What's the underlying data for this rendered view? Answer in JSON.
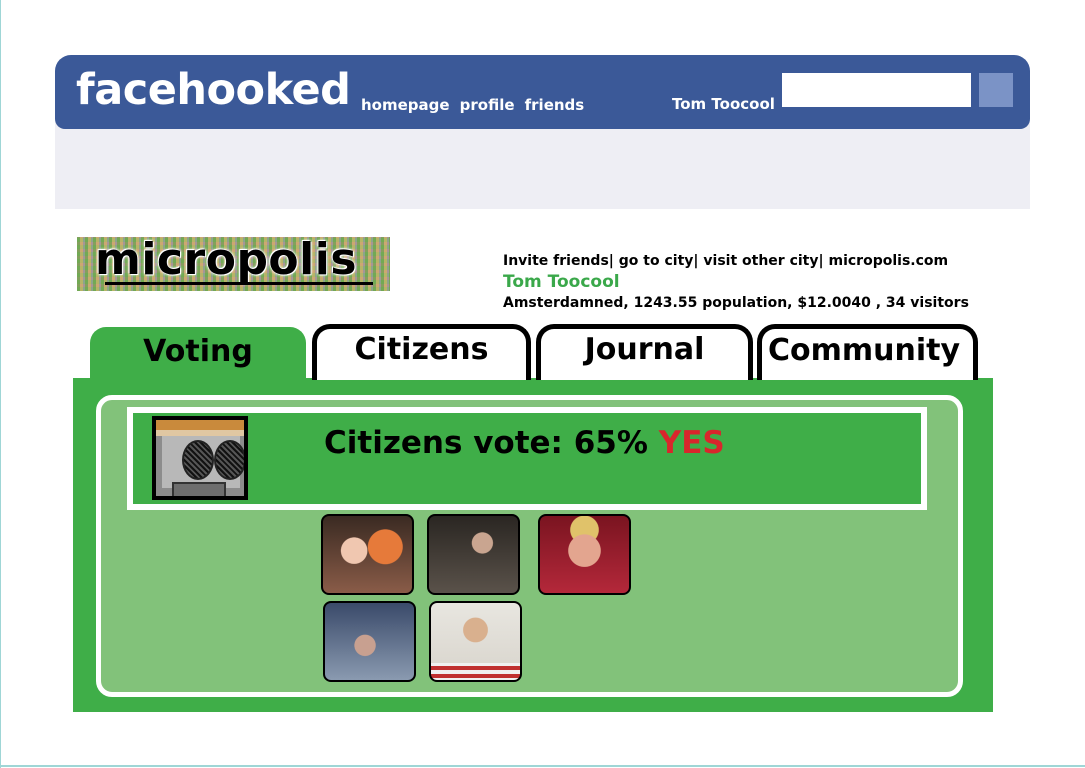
{
  "header": {
    "logo": "facehooked",
    "nav": [
      {
        "label": "homepage"
      },
      {
        "label": "profile"
      },
      {
        "label": "friends"
      }
    ],
    "user_name": "Tom Toocool",
    "search": {
      "value": "",
      "placeholder": ""
    }
  },
  "app": {
    "logo_text": "micropolis",
    "links": [
      {
        "label": "Invite friends"
      },
      {
        "label": "go to city"
      },
      {
        "label": "visit other city"
      },
      {
        "label": "micropolis.com"
      }
    ],
    "separator": "| ",
    "user_name": "Tom Toocool",
    "city_stats": "Amsterdamned, 1243.55 population, $12.0040 , 34 visitors"
  },
  "tabs": [
    {
      "label": "Voting",
      "active": true
    },
    {
      "label": "Citizens",
      "active": false
    },
    {
      "label": "Journal",
      "active": false
    },
    {
      "label": "Community",
      "active": false
    }
  ],
  "vote": {
    "prefix": "Citizens vote: 65%",
    "result": "YES",
    "percent": 65,
    "icon": "advisor-robot-icon"
  },
  "citizens": [
    {
      "icon": "citizen-photo"
    },
    {
      "icon": "citizen-photo"
    },
    {
      "icon": "citizen-photo"
    },
    {
      "icon": "citizen-photo"
    },
    {
      "icon": "citizen-photo"
    }
  ],
  "colors": {
    "facebook_blue": "#3b5998",
    "green": "#3fae48",
    "light_green": "#82c27a",
    "yes_red": "#d9262c",
    "user_green": "#3aa84a"
  }
}
